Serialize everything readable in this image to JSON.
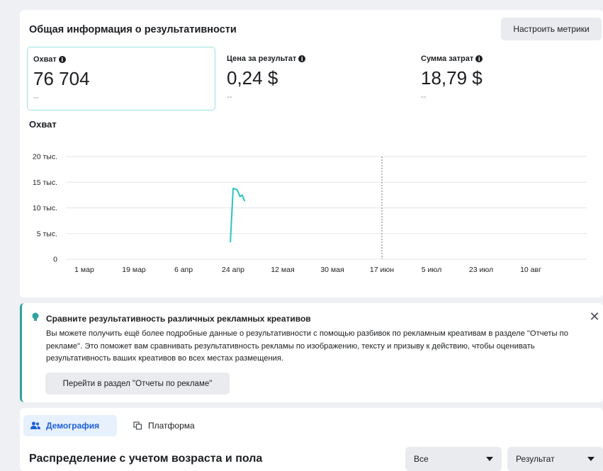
{
  "overview": {
    "title": "Общая информация о результативности",
    "customize_button": "Настроить метрики",
    "metrics": [
      {
        "label": "Охват",
        "value": "76 704",
        "delta": "--"
      },
      {
        "label": "Цена за результат",
        "value": "0,24 $",
        "delta": "--"
      },
      {
        "label": "Сумма затрат",
        "value": "18,79 $",
        "delta": "--"
      }
    ]
  },
  "chart_data": {
    "type": "line",
    "title": "Охват",
    "x_tick_labels": [
      "1 мар",
      "19 мар",
      "6 апр",
      "24 апр",
      "12 мая",
      "30 мая",
      "17 июн",
      "5 июл",
      "23 июл",
      "10 авг"
    ],
    "y_tick_labels": [
      "0",
      "5 тыс.",
      "10 тыс.",
      "15 тыс.",
      "20 тыс."
    ],
    "ylim": [
      0,
      20000
    ],
    "grid": true,
    "marker_line_label": "17 июн",
    "series": [
      {
        "color": "#2ac4c0",
        "points": [
          {
            "day": 53.0,
            "value": 3300
          },
          {
            "day": 54.0,
            "value": 13800
          },
          {
            "day": 55.5,
            "value": 13500
          },
          {
            "day": 56.5,
            "value": 12200
          },
          {
            "day": 57.3,
            "value": 12500
          },
          {
            "day": 58.2,
            "value": 11300
          }
        ]
      }
    ]
  },
  "tip": {
    "title": "Сравните результативность различных рекламных креативов",
    "body": "Вы можете получить ещё более подробные данные о результативности с помощью разбивок по рекламным креативам в разделе \"Отчеты по рекламе\". Это поможет вам сравнивать результативность рекламы по изображению, тексту и призыву к действию, чтобы оценивать результативность ваших креативов во всех местах размещения.",
    "button": "Перейти в раздел \"Отчеты по рекламе\"",
    "close": "✕"
  },
  "breakdown": {
    "tabs": [
      {
        "label": "Демография",
        "icon": "people-icon",
        "active": true
      },
      {
        "label": "Платформа",
        "icon": "devices-icon",
        "active": false
      }
    ],
    "title": "Распределение с учетом возраста и пола",
    "filter_value": "Все",
    "metric_value": "Результат"
  }
}
